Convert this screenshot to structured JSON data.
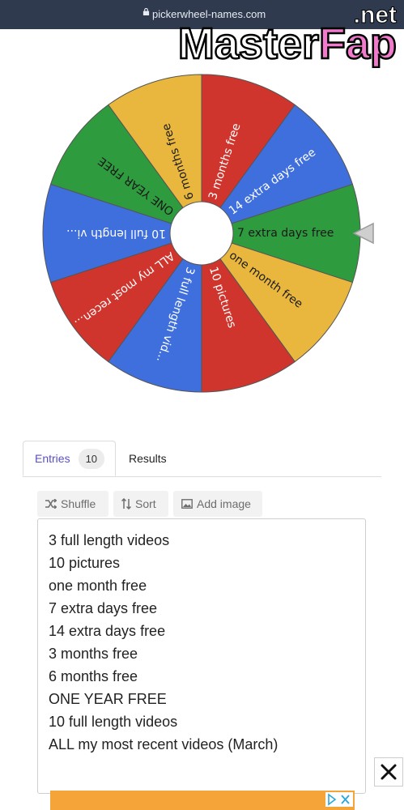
{
  "browser": {
    "url": "pickerwheel-names.com"
  },
  "watermark": {
    "text_main": "MasterFap",
    "text_suffix": ".net"
  },
  "wheel": {
    "segments": [
      {
        "label": "7 extra days free",
        "color": "#2e9b3e",
        "text_color": "#1a1a1a"
      },
      {
        "label": "one month free",
        "color": "#e9b73d",
        "text_color": "#1a1a1a"
      },
      {
        "label": "10 pictures",
        "color": "#d0352d",
        "text_color": "#ffffff"
      },
      {
        "label": "3 full length vid...",
        "color": "#3f6fdc",
        "text_color": "#ffffff"
      },
      {
        "label": "ALL my most recen...",
        "color": "#d0352d",
        "text_color": "#ffffff"
      },
      {
        "label": "10 full length vi...",
        "color": "#3f6fdc",
        "text_color": "#ffffff"
      },
      {
        "label": "ONE YEAR FREE",
        "color": "#2e9b3e",
        "text_color": "#1a1a1a"
      },
      {
        "label": "6 months free",
        "color": "#e9b73d",
        "text_color": "#1a1a1a"
      },
      {
        "label": "3 months free",
        "color": "#d0352d",
        "text_color": "#ffffff"
      },
      {
        "label": "14 extra days free",
        "color": "#3f6fdc",
        "text_color": "#ffffff"
      }
    ]
  },
  "tabs": {
    "entries_label": "Entries",
    "entries_count": "10",
    "results_label": "Results"
  },
  "toolbar": {
    "shuffle_label": "Shuffle",
    "sort_label": "Sort",
    "add_image_label": "Add image"
  },
  "entries": [
    "3 full length videos",
    "10 pictures",
    "one month free",
    "7 extra days free",
    "14 extra days free",
    "3 months free",
    "6 months free",
    "ONE YEAR FREE",
    "10 full length videos",
    "ALL my most recent videos (March)"
  ],
  "ad": {
    "color": "#f5a43a"
  }
}
